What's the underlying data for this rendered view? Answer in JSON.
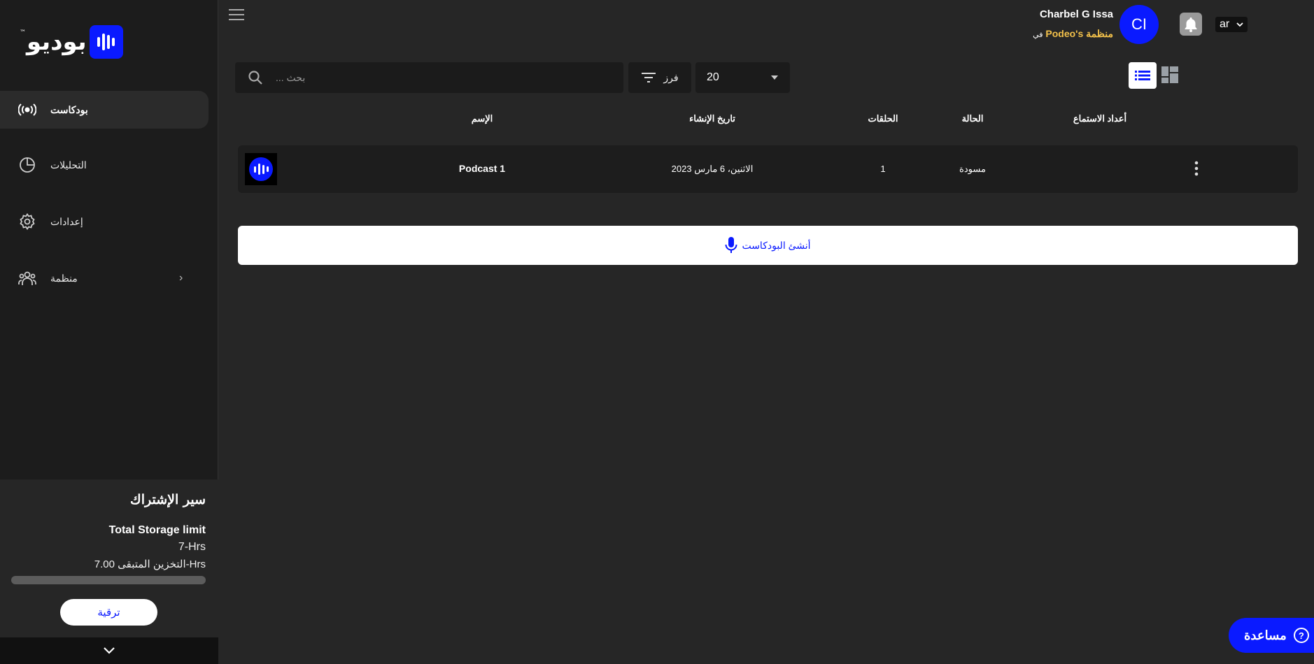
{
  "brand": {
    "logo_text": "بوديو",
    "tm": "™"
  },
  "sidebar": {
    "items": [
      {
        "label": "بودكاست",
        "icon": "podcast-broadcast-icon"
      },
      {
        "label": "التحليلات",
        "icon": "pie-chart-icon"
      },
      {
        "label": "إعدادات",
        "icon": "gear-icon"
      },
      {
        "label": "منظمة",
        "icon": "people-group-icon"
      }
    ],
    "org_chevron": "›"
  },
  "subscription": {
    "title": "سير الإشتراك",
    "storage_label": "Total Storage limit",
    "storage_limit": "7-Hrs",
    "remaining": "التخزين المتبقى 7.00-Hrs",
    "used_fraction": 0.0,
    "upgrade_label": "ترقية"
  },
  "header": {
    "user_name": "Charbel G Issa",
    "org_name": "منظمة Podeo's",
    "org_prefix": "في",
    "avatar_initials": "CI",
    "language": "ar"
  },
  "toolbar": {
    "search_placeholder": "بحث ...",
    "sort_label": "فرز",
    "page_size": "20"
  },
  "table": {
    "headers": {
      "name": "الإسم",
      "created": "تاريخ الإنشاء",
      "episodes": "الحلقات",
      "status": "الحالة",
      "listens": "أعداد الاستماع"
    },
    "rows": [
      {
        "name": "Podcast 1",
        "created": "الاثنين، 6 مارس 2023",
        "episodes": "1",
        "status": "مسودة",
        "listens": ""
      }
    ]
  },
  "create_label": "أنشئ البودكاست",
  "help_label": "مساعدة",
  "colors": {
    "accent": "#0a1aff",
    "org_name": "#f3c14a",
    "background": "#262626",
    "sidebar": "#1c1c1c"
  }
}
